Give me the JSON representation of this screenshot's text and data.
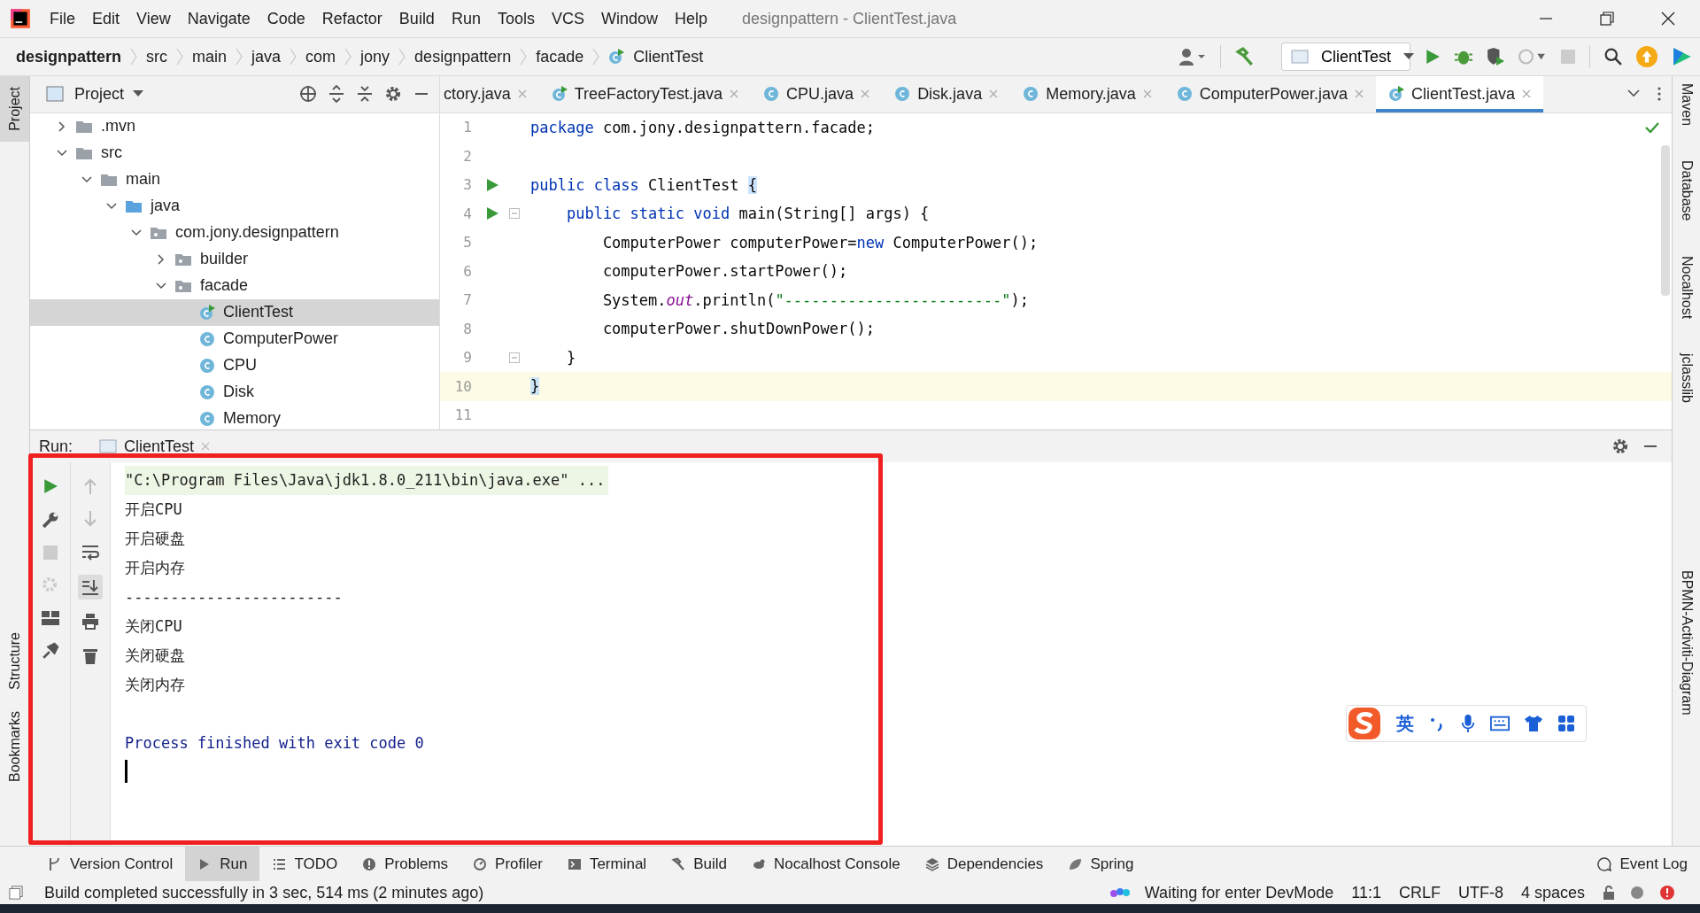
{
  "window": {
    "title": "designpattern - ClientTest.java"
  },
  "menu": [
    "File",
    "Edit",
    "View",
    "Navigate",
    "Code",
    "Refactor",
    "Build",
    "Run",
    "Tools",
    "VCS",
    "Window",
    "Help"
  ],
  "breadcrumbs": [
    {
      "label": "designpattern",
      "kind": "project"
    },
    {
      "label": "src",
      "kind": "dir"
    },
    {
      "label": "main",
      "kind": "dir"
    },
    {
      "label": "java",
      "kind": "dir"
    },
    {
      "label": "com",
      "kind": "dir"
    },
    {
      "label": "jony",
      "kind": "dir"
    },
    {
      "label": "designpattern",
      "kind": "dir"
    },
    {
      "label": "facade",
      "kind": "dir"
    },
    {
      "label": "ClientTest",
      "kind": "class"
    }
  ],
  "run_config": "ClientTest",
  "left_strip": {
    "top": [
      "Project"
    ],
    "bottom": [
      "Structure",
      "Bookmarks"
    ]
  },
  "right_strip": [
    "Maven",
    "Database",
    "Nocalhost",
    "jclasslib",
    "BPMN-Activiti-Diagram"
  ],
  "project_panel": {
    "title": "Project",
    "tree": [
      {
        "label": ".mvn",
        "kind": "folder",
        "expanded": false,
        "selected": false
      },
      {
        "label": "src",
        "kind": "folder",
        "expanded": true,
        "selected": false,
        "children": [
          {
            "label": "main",
            "kind": "folder",
            "expanded": true,
            "selected": false,
            "children": [
              {
                "label": "java",
                "kind": "source-root",
                "expanded": true,
                "selected": false,
                "children": [
                  {
                    "label": "com.jony.designpattern",
                    "kind": "package",
                    "expanded": true,
                    "selected": false,
                    "children": [
                      {
                        "label": "builder",
                        "kind": "package",
                        "expanded": false,
                        "selected": false
                      },
                      {
                        "label": "facade",
                        "kind": "package",
                        "expanded": true,
                        "selected": false,
                        "children": [
                          {
                            "label": "ClientTest",
                            "kind": "runnable-class",
                            "selected": true
                          },
                          {
                            "label": "ComputerPower",
                            "kind": "class",
                            "selected": false
                          },
                          {
                            "label": "CPU",
                            "kind": "class",
                            "selected": false
                          },
                          {
                            "label": "Disk",
                            "kind": "class",
                            "selected": false
                          },
                          {
                            "label": "Memory",
                            "kind": "class",
                            "selected": false
                          }
                        ]
                      }
                    ]
                  }
                ]
              }
            ]
          }
        ]
      }
    ]
  },
  "tabs": [
    {
      "label": "ctory.java",
      "kind": "plain",
      "selected": false
    },
    {
      "label": "TreeFactoryTest.java",
      "kind": "runnable-class",
      "selected": false
    },
    {
      "label": "CPU.java",
      "kind": "class",
      "selected": false
    },
    {
      "label": "Disk.java",
      "kind": "class",
      "selected": false
    },
    {
      "label": "Memory.java",
      "kind": "class",
      "selected": false
    },
    {
      "label": "ComputerPower.java",
      "kind": "class",
      "selected": false
    },
    {
      "label": "ClientTest.java",
      "kind": "runnable-class",
      "selected": true
    }
  ],
  "editor": {
    "lines": [
      {
        "number": "1",
        "run": false,
        "fold": false,
        "current": false,
        "tokens": [
          {
            "text": "package",
            "kind": "keyword"
          },
          {
            "text": " com.jony.designpattern.facade;",
            "kind": "plain"
          }
        ]
      },
      {
        "number": "2",
        "run": false,
        "fold": false,
        "current": false
      },
      {
        "number": "3",
        "run": true,
        "fold": false,
        "current": false,
        "tokens": [
          {
            "text": "public class",
            "kind": "keyword"
          },
          {
            "text": " ClientTest ",
            "kind": "plain"
          },
          {
            "text": "{",
            "kind": "match"
          }
        ]
      },
      {
        "number": "4",
        "run": true,
        "fold": true,
        "current": false,
        "tokens": [
          {
            "text": "    public static void",
            "kind": "keyword"
          },
          {
            "text": " main(String[] args) {",
            "kind": "plain"
          }
        ]
      },
      {
        "number": "5",
        "run": false,
        "fold": false,
        "current": false,
        "tokens": [
          {
            "text": "        ComputerPower computerPower=",
            "kind": "plain"
          },
          {
            "text": "new",
            "kind": "keyword"
          },
          {
            "text": " ComputerPower();",
            "kind": "plain"
          }
        ]
      },
      {
        "number": "6",
        "run": false,
        "fold": false,
        "current": false,
        "tokens": [
          {
            "text": "        computerPower.startPower();",
            "kind": "plain"
          }
        ]
      },
      {
        "number": "7",
        "run": false,
        "fold": false,
        "current": false,
        "tokens": [
          {
            "text": "        System.",
            "kind": "plain"
          },
          {
            "text": "out",
            "kind": "field"
          },
          {
            "text": ".println(",
            "kind": "plain"
          },
          {
            "text": "\"------------------------\"",
            "kind": "string"
          },
          {
            "text": ");",
            "kind": "plain"
          }
        ]
      },
      {
        "number": "8",
        "run": false,
        "fold": false,
        "current": false,
        "tokens": [
          {
            "text": "        computerPower.shutDownPower();",
            "kind": "plain"
          }
        ]
      },
      {
        "number": "9",
        "run": false,
        "fold": true,
        "current": false,
        "tokens": [
          {
            "text": "    }",
            "kind": "plain"
          }
        ]
      },
      {
        "number": "10",
        "run": false,
        "fold": false,
        "current": true,
        "tokens": [
          {
            "text": "}",
            "kind": "match"
          }
        ]
      },
      {
        "number": "11",
        "run": false,
        "fold": false,
        "current": false
      }
    ]
  },
  "run_panel": {
    "label": "Run:",
    "tab": "ClientTest",
    "console": [
      {
        "text": "\"C:\\Program Files\\Java\\jdk1.8.0_211\\bin\\java.exe\" ...",
        "kind": "command"
      },
      {
        "text": "开启CPU",
        "kind": "output"
      },
      {
        "text": "开启硬盘",
        "kind": "output"
      },
      {
        "text": "开启内存",
        "kind": "output"
      },
      {
        "text": "------------------------",
        "kind": "output"
      },
      {
        "text": "关闭CPU",
        "kind": "output"
      },
      {
        "text": "关闭硬盘",
        "kind": "output"
      },
      {
        "text": "关闭内存",
        "kind": "output"
      },
      {
        "text": "Process finished with exit code 0",
        "kind": "exit"
      }
    ]
  },
  "ime_toolbar": {
    "mode": "英"
  },
  "tool_windows": {
    "left": [
      {
        "label": "Version Control",
        "selected": false
      },
      {
        "label": "Run",
        "selected": true
      },
      {
        "label": "TODO",
        "selected": false
      },
      {
        "label": "Problems",
        "selected": false
      },
      {
        "label": "Profiler",
        "selected": false
      },
      {
        "label": "Terminal",
        "selected": false
      },
      {
        "label": "Build",
        "selected": false
      },
      {
        "label": "Nocalhost Console",
        "selected": false
      },
      {
        "label": "Dependencies",
        "selected": false
      },
      {
        "label": "Spring",
        "selected": false
      }
    ],
    "right": [
      {
        "label": "Event Log",
        "selected": false
      }
    ]
  },
  "status_bar": {
    "message": "Build completed successfully in 3 sec, 514 ms (2 minutes ago)",
    "items": [
      "Waiting for enter DevMode",
      "11:1",
      "CRLF",
      "UTF-8",
      "4 spaces"
    ]
  }
}
